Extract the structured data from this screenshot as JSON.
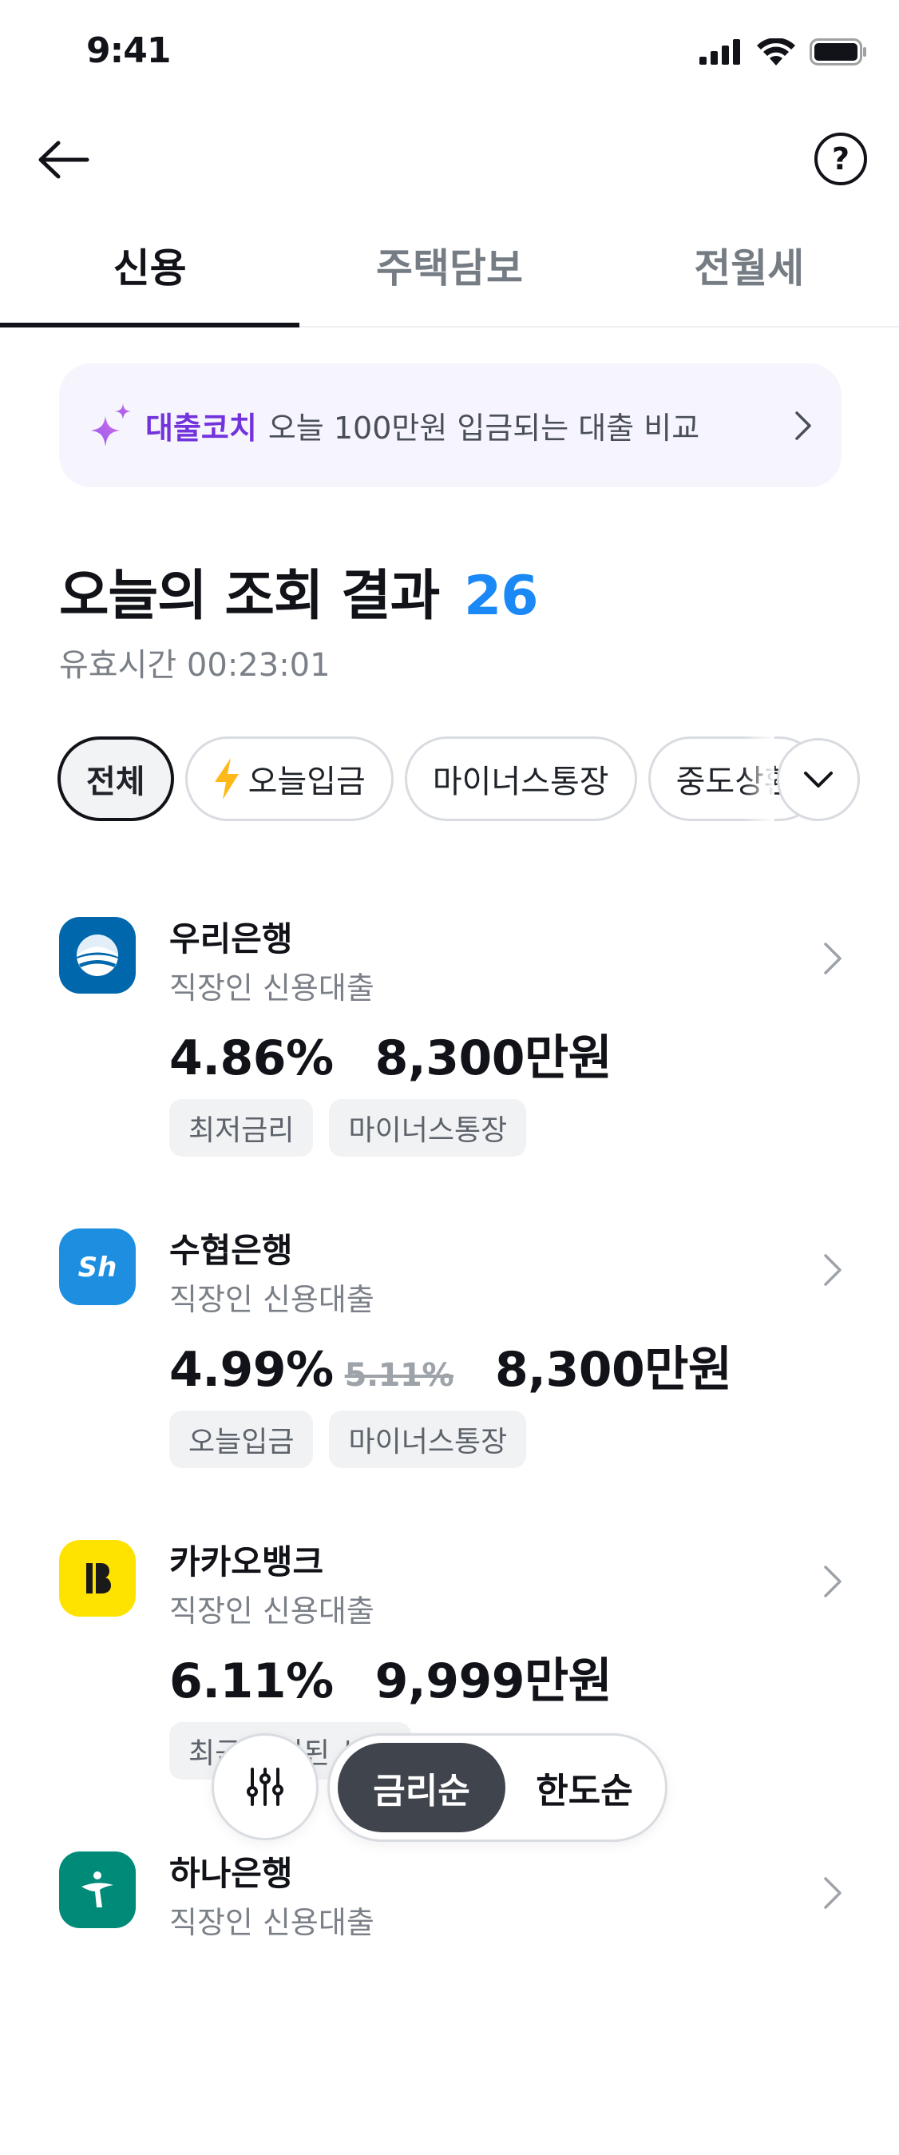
{
  "status_bar": {
    "time": "9:41"
  },
  "tabs": [
    {
      "label": "신용",
      "active": true
    },
    {
      "label": "주택담보",
      "active": false
    },
    {
      "label": "전월세",
      "active": false
    }
  ],
  "coach": {
    "brand": "대출코치",
    "text": "오늘 100만원 입금되는 대출 비교"
  },
  "heading": {
    "title": "오늘의 조회 결과",
    "count": "26"
  },
  "valid_time": "유효시간 00:23:01",
  "chips": [
    {
      "label": "전체",
      "active": true
    },
    {
      "label": "오늘입금",
      "icon": "lightning-icon"
    },
    {
      "label": "마이너스통장"
    },
    {
      "label": "중도상환"
    }
  ],
  "loans": [
    {
      "bank": "우리은행",
      "product": "직장인 신용대출",
      "rate": "4.86%",
      "old_rate": "",
      "limit": "8,300만원",
      "tags": [
        "최저금리",
        "마이너스통장"
      ],
      "logo_color": "#0067ac"
    },
    {
      "bank": "수협은행",
      "product": "직장인 신용대출",
      "rate": "4.99%",
      "old_rate": "5.11%",
      "limit": "8,300만원",
      "tags": [
        "오늘입금",
        "마이너스통장"
      ],
      "logo_color": "#1e8fe0"
    },
    {
      "bank": "카카오뱅크",
      "product": "직장인 신용대출",
      "rate": "6.11%",
      "old_rate": "",
      "limit": "9,999만원",
      "tags": [
        "최근 조회된 상품"
      ],
      "logo_color": "#ffe300"
    },
    {
      "bank": "하나은행",
      "product": "직장인 신용대출",
      "rate": "",
      "old_rate": "",
      "limit": "",
      "tags": [],
      "logo_color": "#008b79"
    }
  ],
  "sort": {
    "options": [
      "금리순",
      "한도순"
    ],
    "selected": "금리순"
  },
  "colors": {
    "accent_blue": "#1a88f5",
    "coach_purple": "#7233dc",
    "dark_pill": "#40454d"
  }
}
